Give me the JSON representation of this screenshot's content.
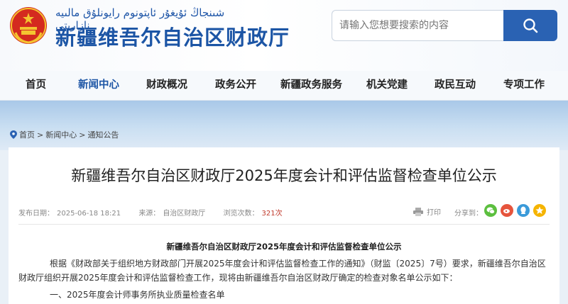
{
  "header": {
    "uyghur_line": "شىنجاڭ ئۇيغۇر ئاپتونوم رايونلۇق مالىيە نازارىتى",
    "site_title": "新疆维吾尔自治区财政厅",
    "search_placeholder": "请输入您想要搜索的内容"
  },
  "nav": {
    "items": [
      "首页",
      "新闻中心",
      "财政概况",
      "政务公开",
      "新疆政务服务",
      "机关党建",
      "政民互动",
      "专项工作"
    ],
    "active_index": 1
  },
  "breadcrumb": [
    "首页",
    "新闻中心",
    "通知公告"
  ],
  "breadcrumb_sep": ">",
  "article": {
    "title": "新疆维吾尔自治区财政厅2025年度会计和评估监督检查单位公示",
    "publish_label": "发布日期：",
    "publish_date": "2025-06-18 18:21",
    "source_label": "来源：",
    "source": "自治区财政厅",
    "views_label": "浏览次数：",
    "views": "321次",
    "print_label": "打印",
    "share_label": "分享到：",
    "doc_heading": "新疆维吾尔自治区财政厅2025年度会计和评估监督检查单位公示",
    "para1": "根据《财政部关于组织地方财政部门开展2025年度会计和评估监督检查工作的通知》（财监〔2025〕7号）要求，新疆维吾尔自治区财政厅组织开展2025年度会计和评估监督检查工作，现将由新疆维吾尔自治区财政厅确定的检查对象名单公示如下：",
    "para2": "一、2025年度会计师事务所执业质量检查名单"
  },
  "colors": {
    "brand_blue": "#1c55a5",
    "search_button": "#2a62b3",
    "views_count": "#c0392b",
    "wechat": "#5cbf3f",
    "weibo": "#e6543c",
    "qq": "#3a9ad9",
    "qzone": "#f5b400"
  },
  "icons": [
    "emblem-icon",
    "search-icon",
    "location-pin-icon",
    "printer-icon",
    "wechat-icon",
    "weibo-icon",
    "qq-icon",
    "qzone-icon"
  ]
}
